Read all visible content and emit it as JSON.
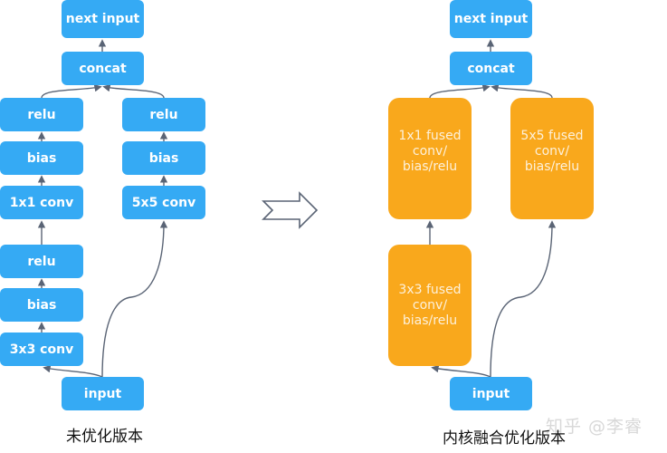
{
  "colors": {
    "unfused_node": "#35aaf4",
    "fused_node": "#f9a81c",
    "edge": "#5a6475"
  },
  "left_diagram": {
    "caption": "未优化版本",
    "nodes": {
      "next_input": "next input",
      "concat": "concat",
      "branch_a_relu": "relu",
      "branch_a_bias": "bias",
      "branch_a_conv": "1x1 conv",
      "branch_b_relu": "relu",
      "branch_b_bias": "bias",
      "branch_b_conv": "5x5 conv",
      "branch_c_relu": "relu",
      "branch_c_bias": "bias",
      "branch_c_conv": "3x3 conv",
      "input": "input"
    }
  },
  "transform_arrow": {
    "icon": "hollow-right-arrow-icon"
  },
  "right_diagram": {
    "caption": "内核融合优化版本",
    "nodes": {
      "next_input": "next input",
      "concat": "concat",
      "fused_1x1": "1x1 fused conv/ bias/relu",
      "fused_5x5": "5x5 fused conv/ bias/relu",
      "fused_3x3": "3x3 fused conv/ bias/relu",
      "input": "input"
    }
  },
  "watermark": "知乎 @李睿"
}
